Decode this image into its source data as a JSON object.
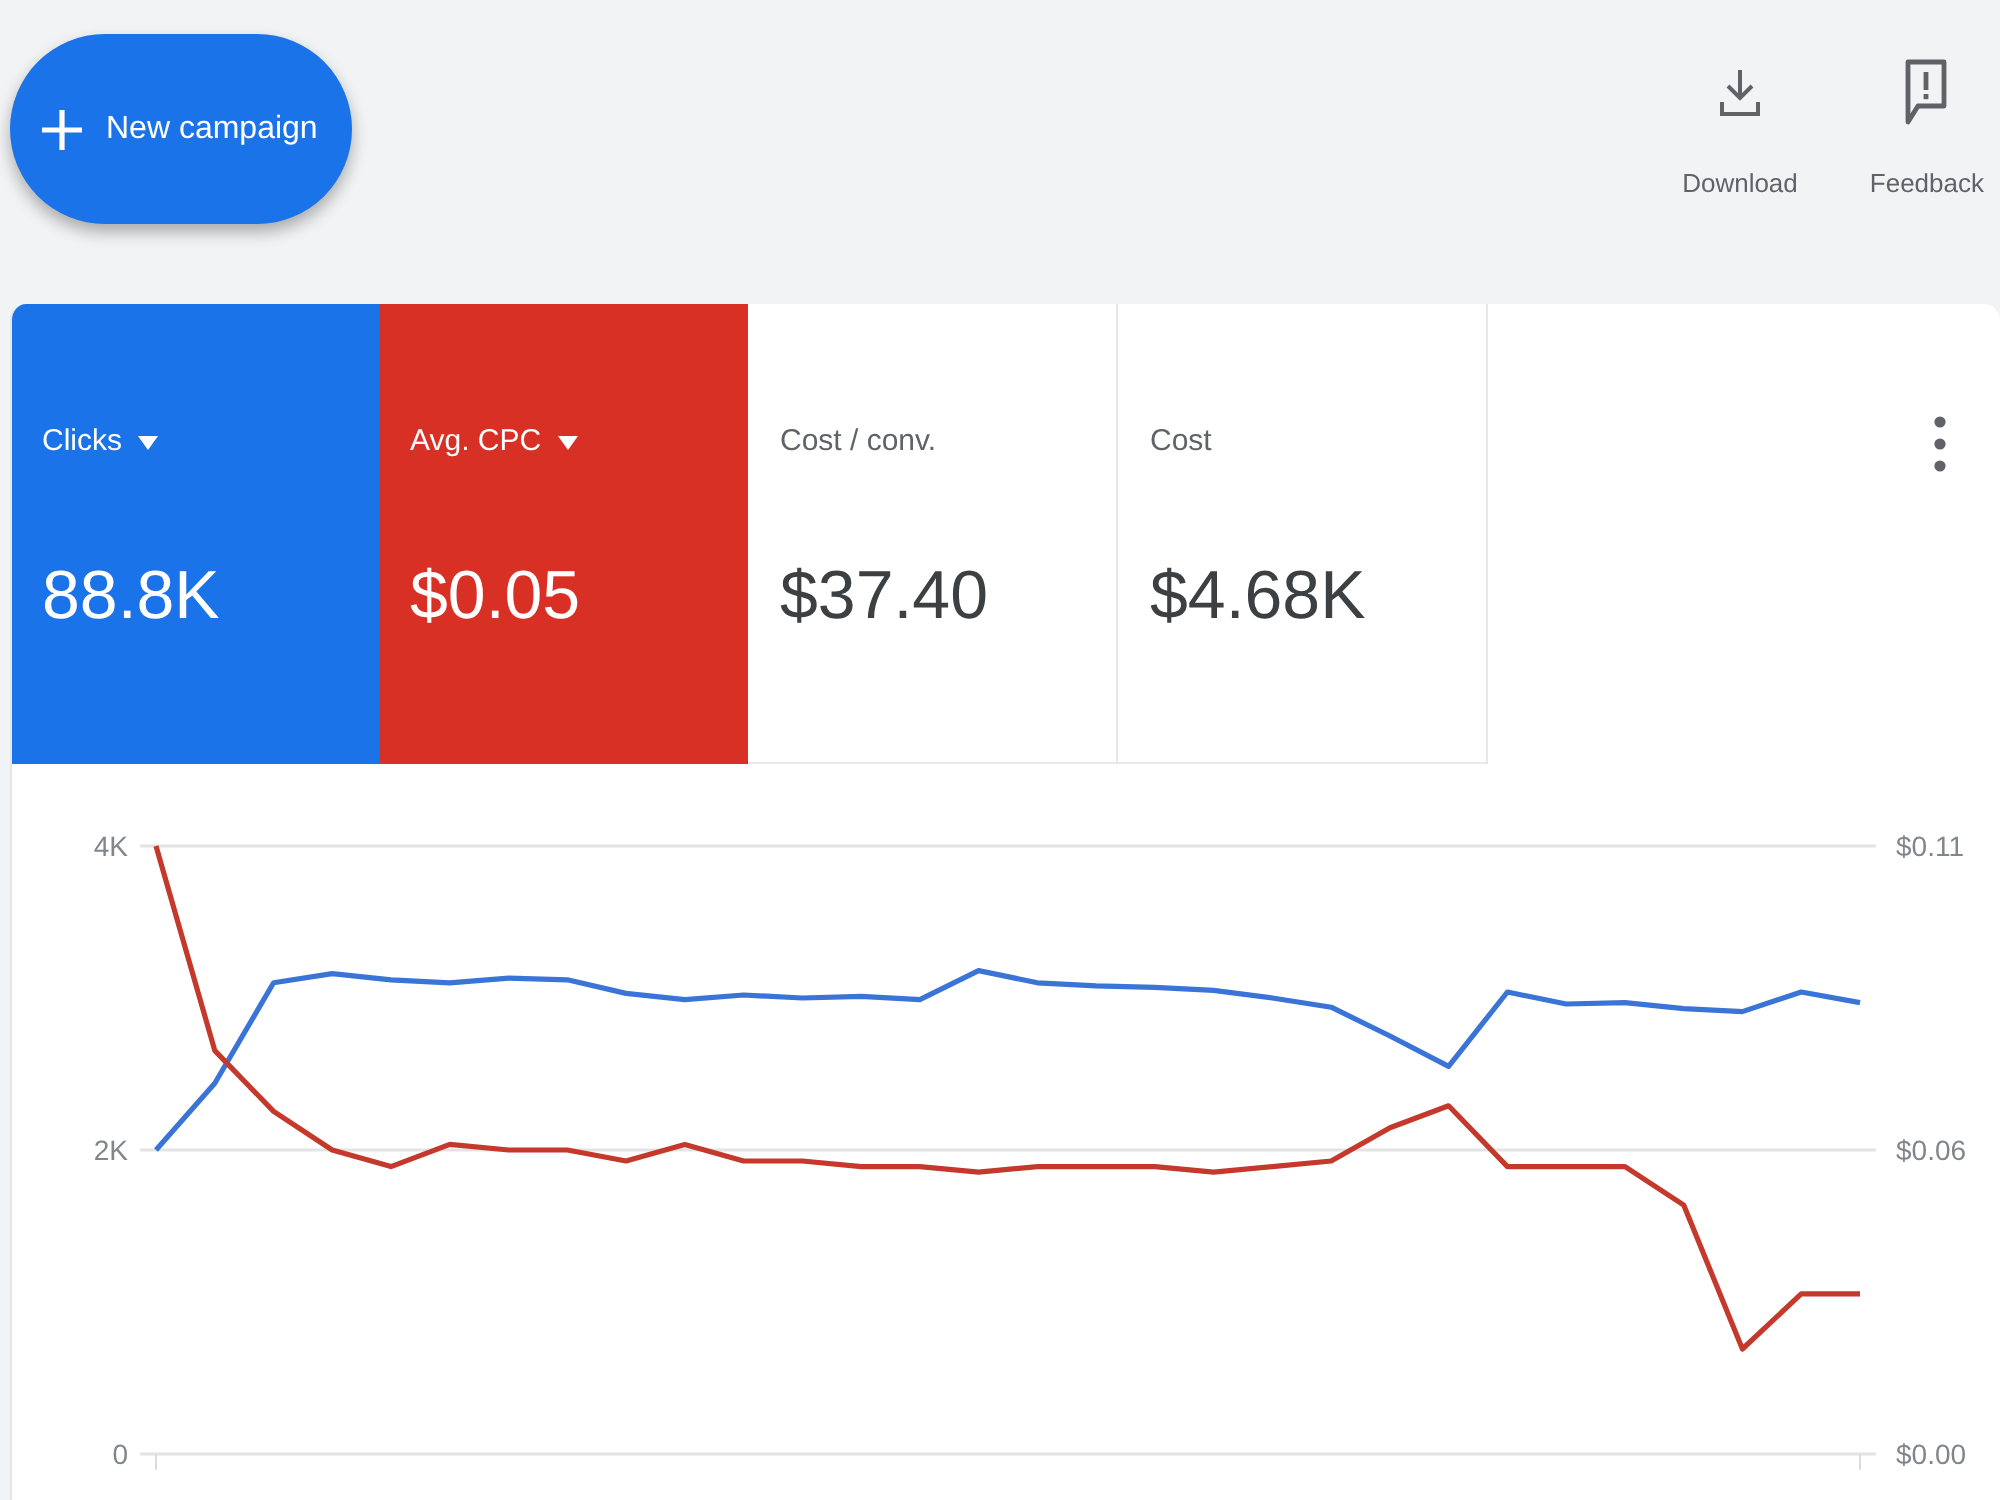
{
  "toolbar": {
    "new_campaign_button": {
      "label": "New campaign"
    },
    "actions": [
      {
        "kind": "download",
        "label": "Download"
      },
      {
        "kind": "feedback",
        "label": "Feedback"
      }
    ]
  },
  "scorecards": [
    {
      "label": "Clicks",
      "value": "88.8K",
      "selected": true,
      "color": "#1a73e8"
    },
    {
      "label": "Avg. CPC",
      "value": "$0.05",
      "selected": true,
      "color": "#d93025"
    },
    {
      "label": "Cost / conv.",
      "value": "$37.40",
      "selected": false
    },
    {
      "label": "Cost",
      "value": "$4.68K",
      "selected": false
    }
  ],
  "chart": {
    "chart_data": {
      "type": "line",
      "ylim": [
        0,
        4000
      ],
      "yticks": [
        {
          "value": 0,
          "label": "0"
        },
        {
          "value": 2000,
          "label": "2K"
        },
        {
          "value": 4000,
          "label": "4K"
        }
      ],
      "y2lim": [
        0,
        0.11
      ],
      "y2ticks": [
        {
          "value": 0,
          "label": "$0.00"
        },
        {
          "value": 0.055,
          "label": "$0.06"
        },
        {
          "value": 0.11,
          "label": "$0.11"
        }
      ],
      "series": [
        {
          "color": "#3a74d6",
          "values": [
            2000,
            2440,
            3100,
            3160,
            3120,
            3100,
            3130,
            3120,
            3030,
            2990,
            3020,
            3000,
            3010,
            2990,
            3180,
            3100,
            3080,
            3070,
            3050,
            3000,
            2940,
            2750,
            2550,
            3040,
            2960,
            2970,
            2930,
            2910,
            3040,
            2970
          ]
        },
        {
          "color": "#c4392c",
          "axis": "y2",
          "values": [
            0.11,
            0.073,
            0.062,
            0.055,
            0.052,
            0.056,
            0.055,
            0.055,
            0.053,
            0.056,
            0.053,
            0.053,
            0.052,
            0.052,
            0.051,
            0.052,
            0.052,
            0.052,
            0.051,
            0.052,
            0.053,
            0.059,
            0.063,
            0.052,
            0.052,
            0.052,
            0.045,
            0.019,
            0.029,
            0.029
          ]
        }
      ]
    }
  }
}
